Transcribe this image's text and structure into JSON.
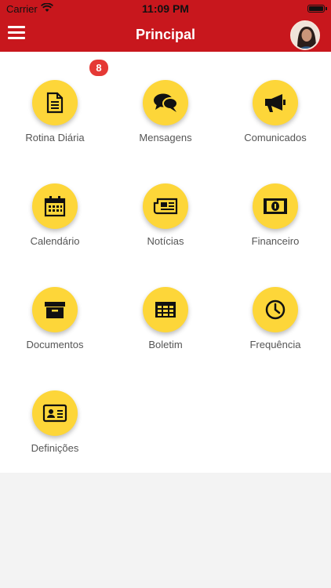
{
  "status_bar": {
    "carrier": "Carrier",
    "time": "11:09 PM"
  },
  "header": {
    "title": "Principal"
  },
  "badge": {
    "count": "8"
  },
  "menu": [
    {
      "label": "Rotina Diária",
      "icon": "document-icon"
    },
    {
      "label": "Mensagens",
      "icon": "chat-bubbles-icon"
    },
    {
      "label": "Comunicados",
      "icon": "megaphone-icon"
    },
    {
      "label": "Calendário",
      "icon": "calendar-icon"
    },
    {
      "label": "Notícias",
      "icon": "newspaper-icon"
    },
    {
      "label": "Financeiro",
      "icon": "money-bill-icon"
    },
    {
      "label": "Documentos",
      "icon": "archive-box-icon"
    },
    {
      "label": "Boletim",
      "icon": "table-grid-icon"
    },
    {
      "label": "Frequência",
      "icon": "clock-icon"
    },
    {
      "label": "Definições",
      "icon": "id-card-icon"
    }
  ],
  "colors": {
    "header": "#c8171d",
    "icon_circle": "#fdd639",
    "badge": "#e53935"
  }
}
